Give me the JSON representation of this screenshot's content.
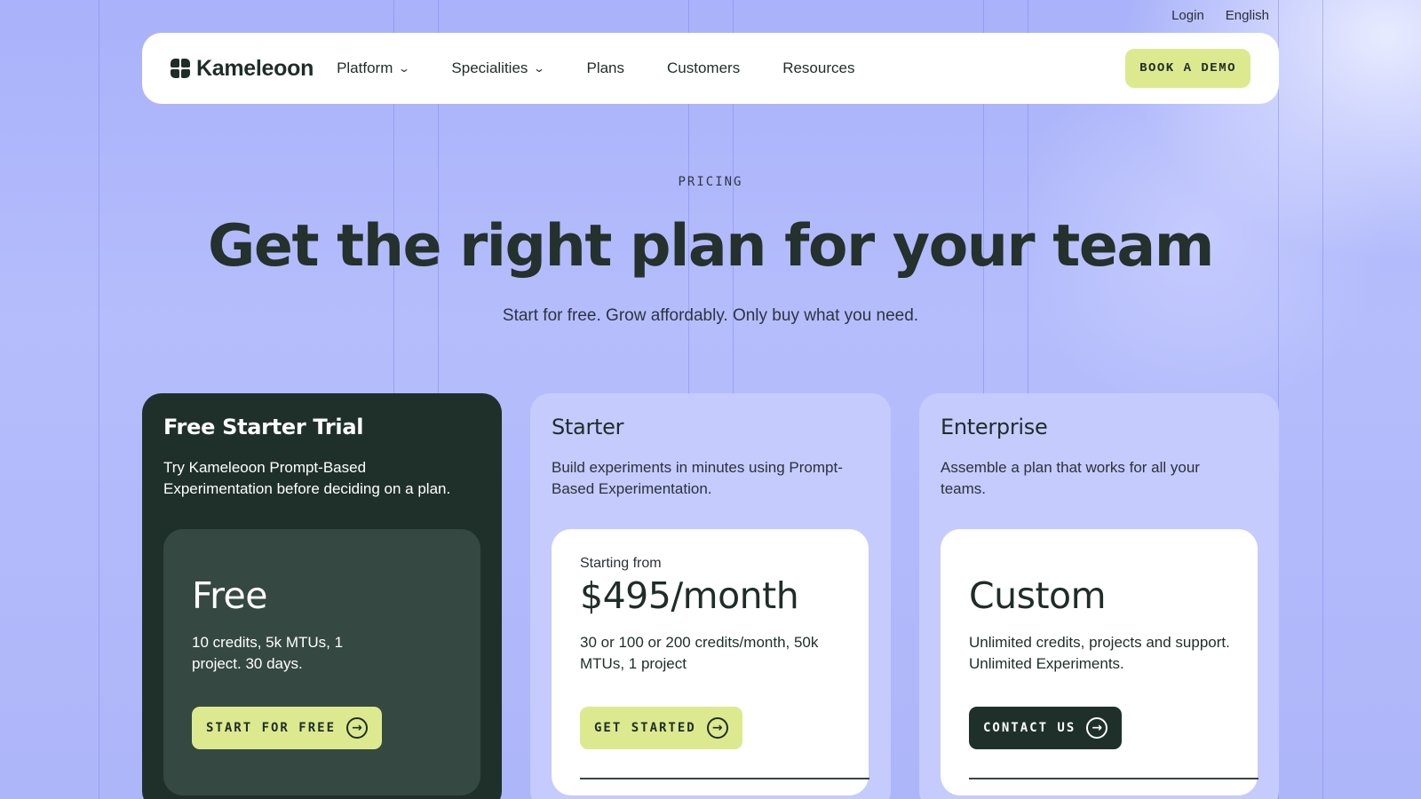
{
  "toplinks": {
    "login": "Login",
    "language": "English"
  },
  "nav": {
    "brand": "Kameleoon",
    "items": [
      {
        "label": "Platform",
        "chevron": true
      },
      {
        "label": "Specialities",
        "chevron": true
      },
      {
        "label": "Plans"
      },
      {
        "label": "Customers"
      },
      {
        "label": "Resources"
      }
    ],
    "cta": "BOOK A DEMO"
  },
  "hero": {
    "eyebrow": "PRICING",
    "title": "Get the right plan for your team",
    "subtitle": "Start for free. Grow affordably. Only buy what you need."
  },
  "plans": [
    {
      "name": "Free Starter Trial",
      "description": "Try Kameleoon Prompt-Based Experimentation before deciding on a plan.",
      "starting": "",
      "price": "Free",
      "details": "10 credits, 5k MTUs, 1 project. 30 days.",
      "cta": "START FOR FREE"
    },
    {
      "name": "Starter",
      "description": "Build experiments in minutes using Prompt-Based Experimentation.",
      "starting": "Starting from",
      "price": "$495/month",
      "details": "30 or 100 or 200 credits/month, 50k MTUs, 1 project",
      "cta": "GET STARTED"
    },
    {
      "name": "Enterprise",
      "description": "Assemble a plan that works for all your teams.",
      "starting": "",
      "price": "Custom",
      "details": "Unlimited credits, projects and support. Unlimited Experiments.",
      "cta": "CONTACT US"
    }
  ],
  "colors": {
    "background": "#b0b8fb",
    "dark": "#1f302b",
    "lime": "#dde98f",
    "card_light": "#c5cbfd"
  }
}
